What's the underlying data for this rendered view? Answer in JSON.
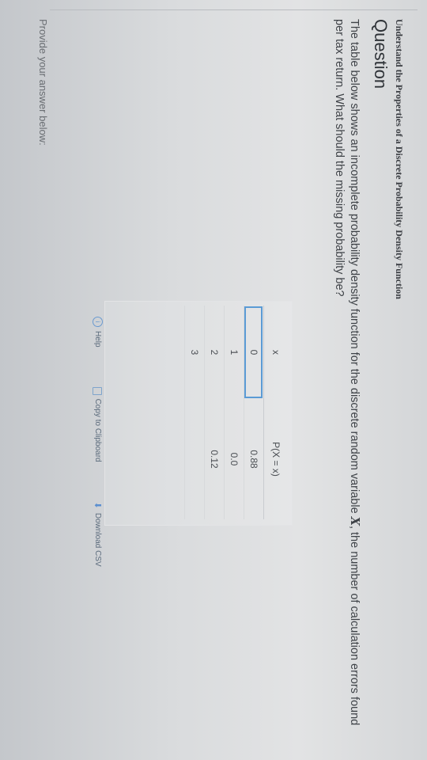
{
  "section_title": "Understand the Properties of a Discrete Probability Density Function",
  "question_heading": "Question",
  "question": {
    "part1": "The table below shows an incomplete probability density function for the discrete random variable ",
    "variable": "X",
    "part2": ", the number of calculation errors found per tax return. What should the missing probability be?"
  },
  "table": {
    "headers": [
      "x",
      "P(X = x)"
    ],
    "rows": [
      [
        "0",
        "0.88"
      ],
      [
        "1",
        "0.0"
      ],
      [
        "2",
        "0.12"
      ],
      [
        "3",
        ""
      ]
    ]
  },
  "toolbar": {
    "help_label": "Help",
    "copy_label": "Copy to Clipboard",
    "download_label": "Download CSV"
  },
  "answer_label": "Provide your answer below:"
}
